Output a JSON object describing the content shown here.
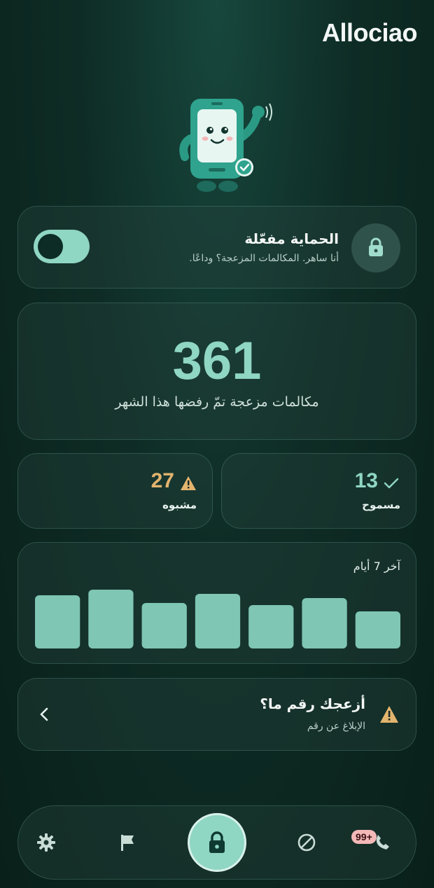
{
  "app": {
    "title": "Allociao"
  },
  "protection": {
    "title": "الحماية مفعّلة",
    "subtitle": "أنا ساهر. المكالمات المزعجة؟ وداعًا.",
    "enabled": true
  },
  "counter": {
    "value": "361",
    "label": "مكالمات مزعجة تمّ رفضها هذا الشهر"
  },
  "stats": {
    "allowed": {
      "value": "13",
      "label": "مسموح",
      "icon": "check-icon",
      "color": "#8fd6c3"
    },
    "suspicious": {
      "value": "27",
      "label": "مشبوه",
      "icon": "warning-icon",
      "color": "#e3b46e"
    }
  },
  "chart_data": {
    "type": "bar",
    "title": "آخر 7 أيام",
    "categories": [],
    "values": [
      76,
      84,
      65,
      78,
      62,
      72,
      53
    ],
    "ylim": [
      0,
      100
    ],
    "bar_color": "#7fc6b4"
  },
  "report": {
    "title": "أزعجك رقم ما؟",
    "subtitle": "الإبلاغ عن رقم"
  },
  "nav": {
    "items": [
      "gear-icon",
      "flag-icon",
      "lock-icon",
      "block-icon",
      "phone-icon"
    ],
    "badge": "99+"
  }
}
